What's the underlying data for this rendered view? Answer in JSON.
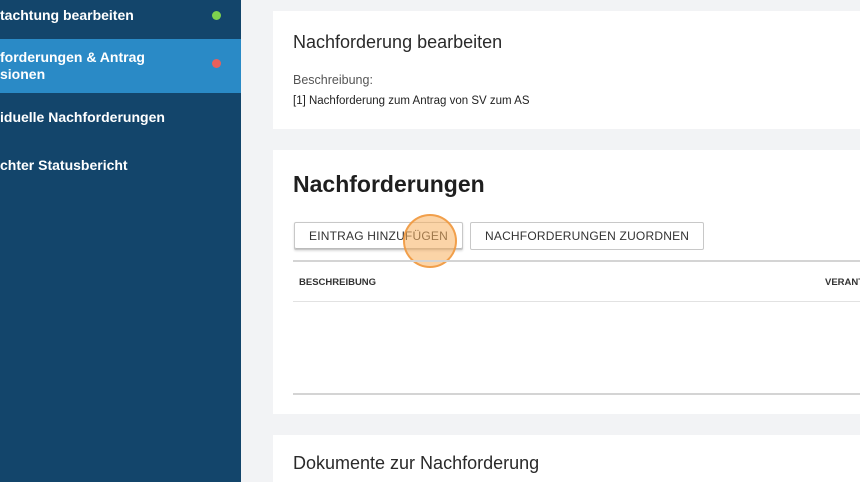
{
  "sidebar": {
    "items": [
      {
        "label": "tachtung bearbeiten",
        "dot_color": "#7ed14e",
        "active": false
      },
      {
        "label_line1": "forderungen & Antrag",
        "label_line2": "sionen",
        "dot_color": "#e8605c",
        "active": true
      },
      {
        "label": "iduelle Nachforderungen"
      },
      {
        "label": "chter Statusbericht"
      }
    ]
  },
  "edit_section": {
    "title": "Nachforderung bearbeiten",
    "description_label": "Beschreibung:",
    "description_value": "[1] Nachforderung zum Antrag von SV zum AS"
  },
  "requests_section": {
    "title": "Nachforderungen",
    "add_button": "EINTRAG HINZUFÜGEN",
    "assign_button": "NACHFORDERUNGEN ZUORDNEN",
    "columns": [
      "BESCHREIBUNG",
      "VERANT"
    ]
  },
  "documents_section": {
    "title": "Dokumente zur Nachforderung"
  },
  "colors": {
    "sidebar_bg": "#13456b",
    "sidebar_active": "#2a8ac6",
    "status_green": "#7ed14e",
    "status_red": "#e8605c",
    "page_bg": "#f2f3f5"
  }
}
